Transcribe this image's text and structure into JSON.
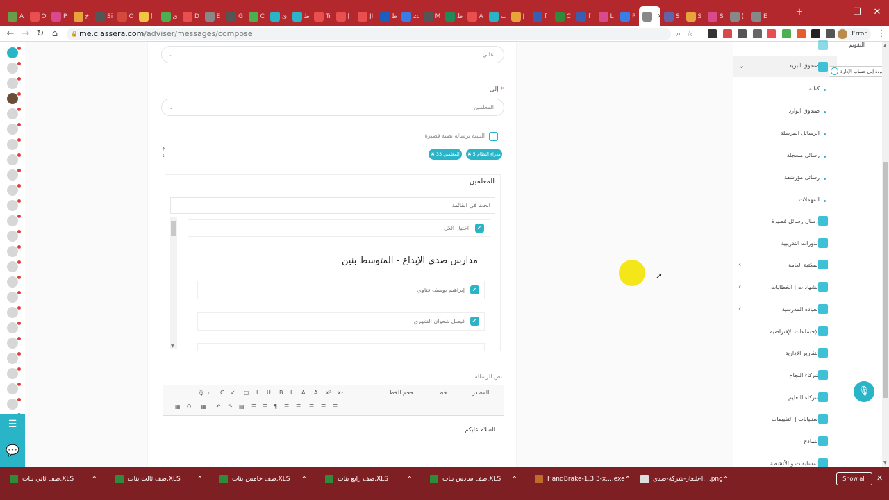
{
  "browser": {
    "tabs": [
      {
        "label": "A",
        "color": "#6a9d4a"
      },
      {
        "label": "O",
        "color": "#e94f4f"
      },
      {
        "label": "P",
        "color": "#d84a8b"
      },
      {
        "label": "خ",
        "color": "#e8a33c"
      },
      {
        "label": "Si",
        "color": "#555"
      },
      {
        "label": "O",
        "color": "#d34a3c"
      },
      {
        "label": "إ",
        "color": "#f4c542"
      },
      {
        "label": "ئ",
        "color": "#4caf50"
      },
      {
        "label": "D",
        "color": "#e94f4f"
      },
      {
        "label": "E",
        "color": "#888"
      },
      {
        "label": "G",
        "color": "#555"
      },
      {
        "label": "C",
        "color": "#4caf50"
      },
      {
        "label": "ئ",
        "color": "#2ab4c8"
      },
      {
        "label": "ط",
        "color": "#2ab4c8"
      },
      {
        "label": "Tr",
        "color": "#e94f4f"
      },
      {
        "label": "إ",
        "color": "#e94f4f"
      },
      {
        "label": "JI",
        "color": "#e94f4f"
      },
      {
        "label": "ط",
        "color": "#1a5fbf"
      },
      {
        "label": "zc",
        "color": "#3a7de8"
      },
      {
        "label": "M",
        "color": "#555"
      },
      {
        "label": "ط",
        "color": "#1e8c5a"
      },
      {
        "label": "A",
        "color": "#e94f4f"
      },
      {
        "label": "ب",
        "color": "#2ab4c8"
      },
      {
        "label": "J",
        "color": "#e8a33c"
      },
      {
        "label": "f",
        "color": "#3a5fb0"
      },
      {
        "label": "C",
        "color": "#2e8b3a"
      },
      {
        "label": "f",
        "color": "#3a5fb0"
      },
      {
        "label": "L",
        "color": "#d84a8b"
      },
      {
        "label": "P",
        "color": "#3a7de8"
      },
      {
        "label": "",
        "color": "#888"
      },
      {
        "label": "S",
        "color": "#6264a7"
      },
      {
        "label": "S",
        "color": "#e8a33c"
      },
      {
        "label": "S",
        "color": "#d84a8b"
      },
      {
        "label": "(",
        "color": "#888"
      },
      {
        "label": "E",
        "color": "#888"
      }
    ],
    "new_tab": "+",
    "url_host": "me.classera.com",
    "url_path": "/adviser/messages/compose",
    "profile_label": "Error"
  },
  "compose": {
    "top_select": "عالي",
    "to_label": "إلى",
    "to_required": "*",
    "to_select": "المعلمين",
    "sms_notify_label": "التنبيه برسالة نصية قصيرة",
    "chips": [
      "✖ مدراء النظام 5",
      "✖ المعلمين 33"
    ],
    "list_title": "المعلمين",
    "search_placeholder": "ابحث في القائمة",
    "select_all": "اختيار الكل",
    "school_name": "مدارس صدى الإبداع - المتوسط بنين",
    "teachers": [
      "إبراهيم يوسف فتاوي",
      "فيصل شعوان الشهري"
    ],
    "message_label": "نص الرسالة",
    "toolbar": {
      "source": "المصدر",
      "font": "خط",
      "font_size": "حجم الخط"
    },
    "message_body": "السلام عليكم"
  },
  "sidebar": {
    "calendar": "التقويم",
    "inbox_parent": "صندوق البريد",
    "tooltip": "العودة إلى حساب الإدارة",
    "mail_sub": [
      "كتابة",
      "صندوق الوارد",
      "الرسائل المرسلة",
      "رسائل مسجلة",
      "رسائل مؤرشفة",
      "المهملات"
    ],
    "items": [
      "إرسال رسائل قصيرة",
      "الدورات التدريبية",
      "المكتبة العامة",
      "الشهادات | الخطابات",
      "العيادة المدرسية",
      "الإجتماعات الإفتراضية",
      "التقارير الإدارية",
      "شركاء النجاح",
      "شركاء التعليم",
      "استبيانات | التقييمات",
      "النماذج",
      "المسابقات و الأنشطة"
    ],
    "accent": "#3ec1d6"
  },
  "taskbar": {
    "items": [
      "صف ثاني بنات.XLS",
      "صف ثالث بنات.XLS",
      "صف خامس بنات.XLS",
      "صف رابع بنات.XLS",
      "صف سادس بنات.XLS",
      "HandBrake-1.3.3-x....exe",
      "شعار-شركة-صدى-l....png"
    ],
    "show_all": "Show all"
  }
}
